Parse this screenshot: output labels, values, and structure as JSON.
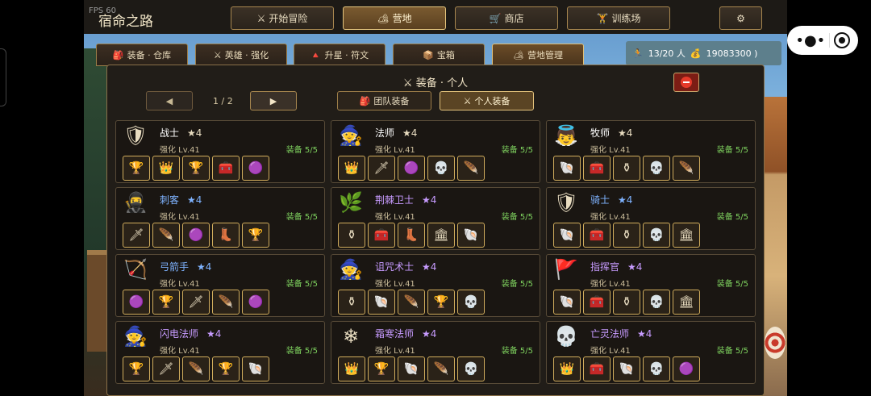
{
  "fps": "FPS 60",
  "game_title": "宿命之路",
  "nav": [
    {
      "icon": "⚔",
      "label": "开始冒险",
      "active": false
    },
    {
      "icon": "🏕",
      "label": "营地",
      "active": true
    },
    {
      "icon": "🛒",
      "label": "商店",
      "active": false
    },
    {
      "icon": "🏋",
      "label": "训练场",
      "active": false
    }
  ],
  "settings_icon": "⚙",
  "subtabs": [
    {
      "icon": "🎒",
      "label": "装备 · 仓库",
      "active": false
    },
    {
      "icon": "⚔",
      "label": "英雄 · 强化",
      "active": false
    },
    {
      "icon": "🔺",
      "label": "升星 · 符文",
      "active": false
    },
    {
      "icon": "📦",
      "label": "宝箱",
      "active": false
    },
    {
      "icon": "🏕",
      "label": "营地管理",
      "active": true
    }
  ],
  "resources": {
    "people_icon": "🏃",
    "people": "13/20 人",
    "gold_icon": "💰",
    "gold": "19083300 )"
  },
  "panel": {
    "title": "⚔ 装备 · 个人",
    "prev": "◀",
    "page": "1 / 2",
    "next": "▶",
    "team_btn": {
      "icon": "🎒",
      "label": "团队装备"
    },
    "personal_btn": {
      "icon": "⚔",
      "label": "个人装备"
    }
  },
  "heroes": [
    {
      "name": "战士",
      "star": "★4",
      "level": "强化 Lv.41",
      "equip": "装备 5/5",
      "color": "warrior",
      "avatar": "🛡",
      "slots": [
        "🏆",
        "👑",
        "🏆",
        "🧰",
        "🟣"
      ]
    },
    {
      "name": "法师",
      "star": "★4",
      "level": "强化 Lv.41",
      "equip": "装备 5/5",
      "color": "warrior",
      "avatar": "🧙",
      "slots": [
        "👑",
        "🗡",
        "🟣",
        "💀",
        "🪶"
      ]
    },
    {
      "name": "牧师",
      "star": "★4",
      "level": "强化 Lv.41",
      "equip": "装备 5/5",
      "color": "warrior",
      "avatar": "👼",
      "slots": [
        "🐚",
        "🧰",
        "⚱",
        "💀",
        "🪶"
      ]
    },
    {
      "name": "刺客",
      "star": "★4",
      "level": "强化 Lv.41",
      "equip": "装备 5/5",
      "color": "blue",
      "avatar": "🥷",
      "slots": [
        "🗡",
        "🪶",
        "🟣",
        "👢",
        "🏆"
      ]
    },
    {
      "name": "荆棘卫士",
      "star": "★4",
      "level": "强化 Lv.41",
      "equip": "装备 5/5",
      "color": "purple",
      "avatar": "🌿",
      "slots": [
        "⚱",
        "🧰",
        "👢",
        "🏛",
        "🐚"
      ]
    },
    {
      "name": "骑士",
      "star": "★4",
      "level": "强化 Lv.41",
      "equip": "装备 5/5",
      "color": "blue",
      "avatar": "🛡",
      "slots": [
        "🐚",
        "🧰",
        "⚱",
        "💀",
        "🏛"
      ]
    },
    {
      "name": "弓箭手",
      "star": "★4",
      "level": "强化 Lv.41",
      "equip": "装备 5/5",
      "color": "blue",
      "avatar": "🏹",
      "slots": [
        "🟣",
        "🏆",
        "🗡",
        "🪶",
        "🟣"
      ]
    },
    {
      "name": "诅咒术士",
      "star": "★4",
      "level": "强化 Lv.41",
      "equip": "装备 5/5",
      "color": "purple",
      "avatar": "🧙",
      "slots": [
        "⚱",
        "🐚",
        "🪶",
        "🏆",
        "💀"
      ]
    },
    {
      "name": "指挥官",
      "star": "★4",
      "level": "强化 Lv.41",
      "equip": "装备 5/5",
      "color": "purple",
      "avatar": "🚩",
      "slots": [
        "🐚",
        "🧰",
        "⚱",
        "💀",
        "🏛"
      ]
    },
    {
      "name": "闪电法师",
      "star": "★4",
      "level": "强化 Lv.41",
      "equip": "装备 5/5",
      "color": "purple",
      "avatar": "🧙",
      "slots": [
        "🏆",
        "🗡",
        "🪶",
        "🏆",
        "🐚"
      ]
    },
    {
      "name": "霜寒法师",
      "star": "★4",
      "level": "强化 Lv.41",
      "equip": "装备 5/5",
      "color": "purple",
      "avatar": "❄",
      "slots": [
        "👑",
        "🏆",
        "🐚",
        "🪶",
        "💀"
      ]
    },
    {
      "name": "亡灵法师",
      "star": "★4",
      "level": "强化 Lv.41",
      "equip": "装备 5/5",
      "color": "purple",
      "avatar": "💀",
      "slots": [
        "👑",
        "🧰",
        "🐚",
        "💀",
        "🟣"
      ]
    }
  ],
  "system": {
    "menu_icon": "•●•",
    "close_icon": "capsule-close"
  }
}
